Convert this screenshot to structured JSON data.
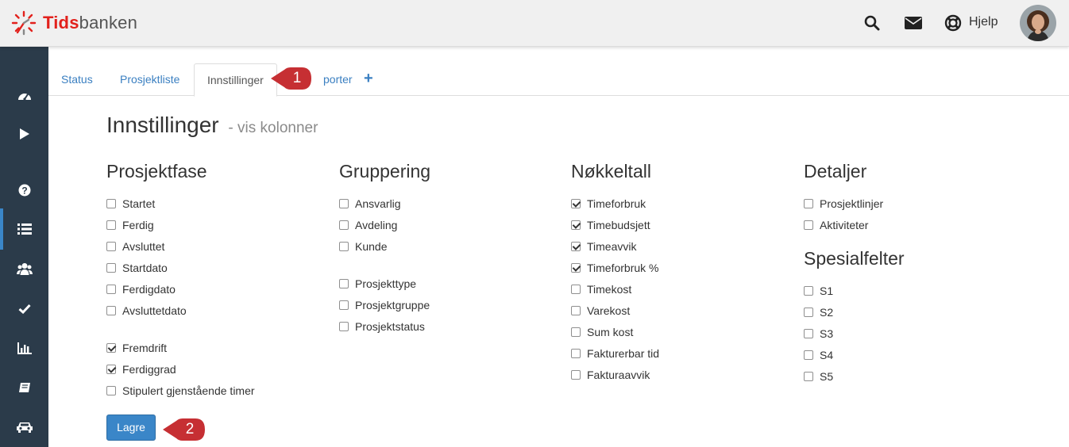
{
  "header": {
    "logo_text_red": "Tids",
    "logo_text_gray": "banken",
    "icons": [
      "search-icon",
      "envelope-icon",
      "life-ring-icon"
    ],
    "help_label": "Hjelp",
    "brand_color": "#e2211c"
  },
  "sidebar": {
    "items": [
      {
        "icon": "dashboard-icon"
      },
      {
        "icon": "play-icon"
      },
      {
        "icon": "question-icon"
      },
      {
        "icon": "list-icon",
        "active": true
      },
      {
        "icon": "users-icon"
      },
      {
        "icon": "check-icon"
      },
      {
        "icon": "bar-chart-icon"
      },
      {
        "icon": "book-icon"
      },
      {
        "icon": "car-icon"
      }
    ],
    "background": "#2b3b4a",
    "active_color": "#3a86c8"
  },
  "tabs": {
    "items": [
      "Status",
      "Prosjektliste",
      "Innstillinger",
      "porter"
    ],
    "active": "Innstillinger",
    "add_icon": "+"
  },
  "callouts": [
    "1",
    "2"
  ],
  "page": {
    "title": "Innstillinger",
    "subtitle": "- vis kolonner"
  },
  "columns": {
    "prosjektfase": {
      "title": "Prosjektfase",
      "items": [
        {
          "label": "Startet",
          "checked": false
        },
        {
          "label": "Ferdig",
          "checked": false
        },
        {
          "label": "Avsluttet",
          "checked": false
        },
        {
          "label": "Startdato",
          "checked": false
        },
        {
          "label": "Ferdigdato",
          "checked": false
        },
        {
          "label": "Avsluttetdato",
          "checked": false
        },
        {
          "label": "Fremdrift",
          "checked": true
        },
        {
          "label": "Ferdiggrad",
          "checked": true
        },
        {
          "label": "Stipulert gjenstående timer",
          "checked": false
        }
      ]
    },
    "gruppering": {
      "title": "Gruppering",
      "items": [
        {
          "label": "Ansvarlig",
          "checked": false
        },
        {
          "label": "Avdeling",
          "checked": false
        },
        {
          "label": "Kunde",
          "checked": false
        },
        {
          "label": "Prosjekttype",
          "checked": false
        },
        {
          "label": "Prosjektgruppe",
          "checked": false
        },
        {
          "label": "Prosjektstatus",
          "checked": false
        }
      ]
    },
    "nokkeltall": {
      "title": "Nøkkeltall",
      "items": [
        {
          "label": "Timeforbruk",
          "checked": true
        },
        {
          "label": "Timebudsjett",
          "checked": true
        },
        {
          "label": "Timeavvik",
          "checked": true
        },
        {
          "label": "Timeforbruk %",
          "checked": true
        },
        {
          "label": "Timekost",
          "checked": false
        },
        {
          "label": "Varekost",
          "checked": false
        },
        {
          "label": "Sum kost",
          "checked": false
        },
        {
          "label": "Fakturerbar tid",
          "checked": false
        },
        {
          "label": "Fakturaavvik",
          "checked": false
        }
      ]
    },
    "detaljer": {
      "title": "Detaljer",
      "items": [
        {
          "label": "Prosjektlinjer",
          "checked": false
        },
        {
          "label": "Aktiviteter",
          "checked": false
        }
      ]
    },
    "spesialfelter": {
      "title": "Spesialfelter",
      "items": [
        {
          "label": "S1",
          "checked": false
        },
        {
          "label": "S2",
          "checked": false
        },
        {
          "label": "S3",
          "checked": false
        },
        {
          "label": "S4",
          "checked": false
        },
        {
          "label": "S5",
          "checked": false
        }
      ]
    }
  },
  "save_label": "Lagre",
  "accent_color": "#3a86c8",
  "callout_color": "#c62f33"
}
